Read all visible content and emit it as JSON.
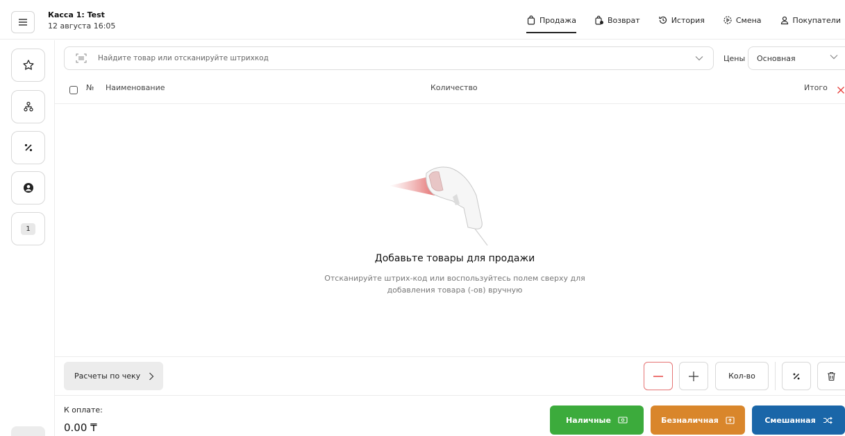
{
  "header": {
    "title": "Касса 1: Test",
    "subtitle": "12 августа 16:05",
    "nav": [
      {
        "label": "Продажа",
        "icon": "bag-icon",
        "active": true
      },
      {
        "label": "Возврат",
        "icon": "return-bag-icon"
      },
      {
        "label": "История",
        "icon": "history-icon"
      },
      {
        "label": "Смена",
        "icon": "shift-icon"
      },
      {
        "label": "Покупатели",
        "icon": "user-icon"
      }
    ]
  },
  "sidebar": {
    "badge": "1"
  },
  "search": {
    "placeholder": "Найдите товар или отсканируйте штрихкод",
    "prices_label": "Цены",
    "prices_value": "Основная"
  },
  "table": {
    "columns": [
      "№",
      "Наименование",
      "Количество",
      "Итого"
    ]
  },
  "empty": {
    "title": "Добавьте товары для продажи",
    "text": "Отсканируйте штрих-код или воспользуйтесь полем сверху для добавления товара (-ов) вручную"
  },
  "toolbar": {
    "receipt_label": "Расчеты по чеку",
    "qty_label": "Кол-во"
  },
  "payment": {
    "label": "К оплате:",
    "amount": "0.00 ₸",
    "cash": "Наличные",
    "card": "Безналичная",
    "mixed": "Смешанная"
  },
  "colors": {
    "cash": "#3cab3c",
    "card": "#d9862b",
    "mixed": "#1a66a8",
    "delete": "#e53935"
  }
}
